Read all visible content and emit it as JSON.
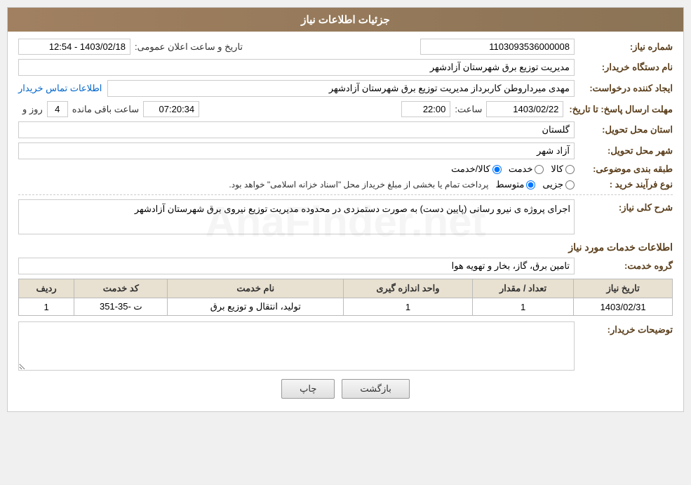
{
  "page": {
    "title": "جزئیات اطلاعات نیاز",
    "watermark": "AnaFinder.net"
  },
  "fields": {
    "need_number_label": "شماره نیاز:",
    "need_number_value": "1103093536000008",
    "buyer_org_label": "نام دستگاه خریدار:",
    "buyer_org_value": "مدیریت توزیع برق شهرستان آزادشهر",
    "creator_label": "ایجاد کننده درخواست:",
    "creator_value": "مهدی میرداروطن کاربرداز مدیریت توزیع برق شهرستان آزادشهر",
    "contact_link": "اطلاعات تماس خریدار",
    "response_deadline_label": "مهلت ارسال پاسخ: تا تاریخ:",
    "response_date": "1403/02/22",
    "response_time_label": "ساعت:",
    "response_time": "22:00",
    "response_days_label": "روز و",
    "response_days": "4",
    "response_remaining_label": "ساعت باقی مانده",
    "response_remaining": "07:20:34",
    "delivery_province_label": "استان محل تحویل:",
    "delivery_province": "گلستان",
    "delivery_city_label": "شهر محل تحویل:",
    "delivery_city": "آزاد شهر",
    "category_label": "طبقه بندی موضوعی:",
    "category_option1": "کالا",
    "category_option2": "خدمت",
    "category_option3": "کالا/خدمت",
    "category_selected": "کالا/خدمت",
    "purchase_type_label": "نوع فرآیند خرید :",
    "purchase_option1": "جزیی",
    "purchase_option2": "متوسط",
    "purchase_option3_text": "پرداخت تمام یا بخشی از مبلغ خریداز محل \"اسناد خزانه اسلامی\" خواهد بود.",
    "announcement_label": "تاریخ و ساعت اعلان عمومی:",
    "announcement_value": "1403/02/18 - 12:54",
    "need_description_label": "شرح کلی نیاز:",
    "need_description": "اجرای پروژه ی نیرو رسانی (پایین دست) به صورت دستمزدی در محدوده مدیریت توزیع نیروی برق شهرستان آزادشهر",
    "services_section_label": "اطلاعات خدمات مورد نیاز",
    "service_group_label": "گروه خدمت:",
    "service_group_value": "تامین برق، گاز، بخار و تهویه هوا",
    "table_headers": {
      "row_num": "ردیف",
      "service_code": "کد خدمت",
      "service_name": "نام خدمت",
      "unit": "واحد اندازه گیری",
      "quantity": "تعداد / مقدار",
      "need_date": "تاریخ نیاز"
    },
    "table_rows": [
      {
        "row_num": "1",
        "service_code": "ت -35-351",
        "service_name": "تولید، انتقال و توزیع برق",
        "unit": "1",
        "quantity": "1",
        "need_date": "1403/02/31"
      }
    ],
    "buyer_description_label": "توضیحات خریدار:",
    "buyer_description_value": "",
    "btn_print": "چاپ",
    "btn_back": "بازگشت"
  }
}
